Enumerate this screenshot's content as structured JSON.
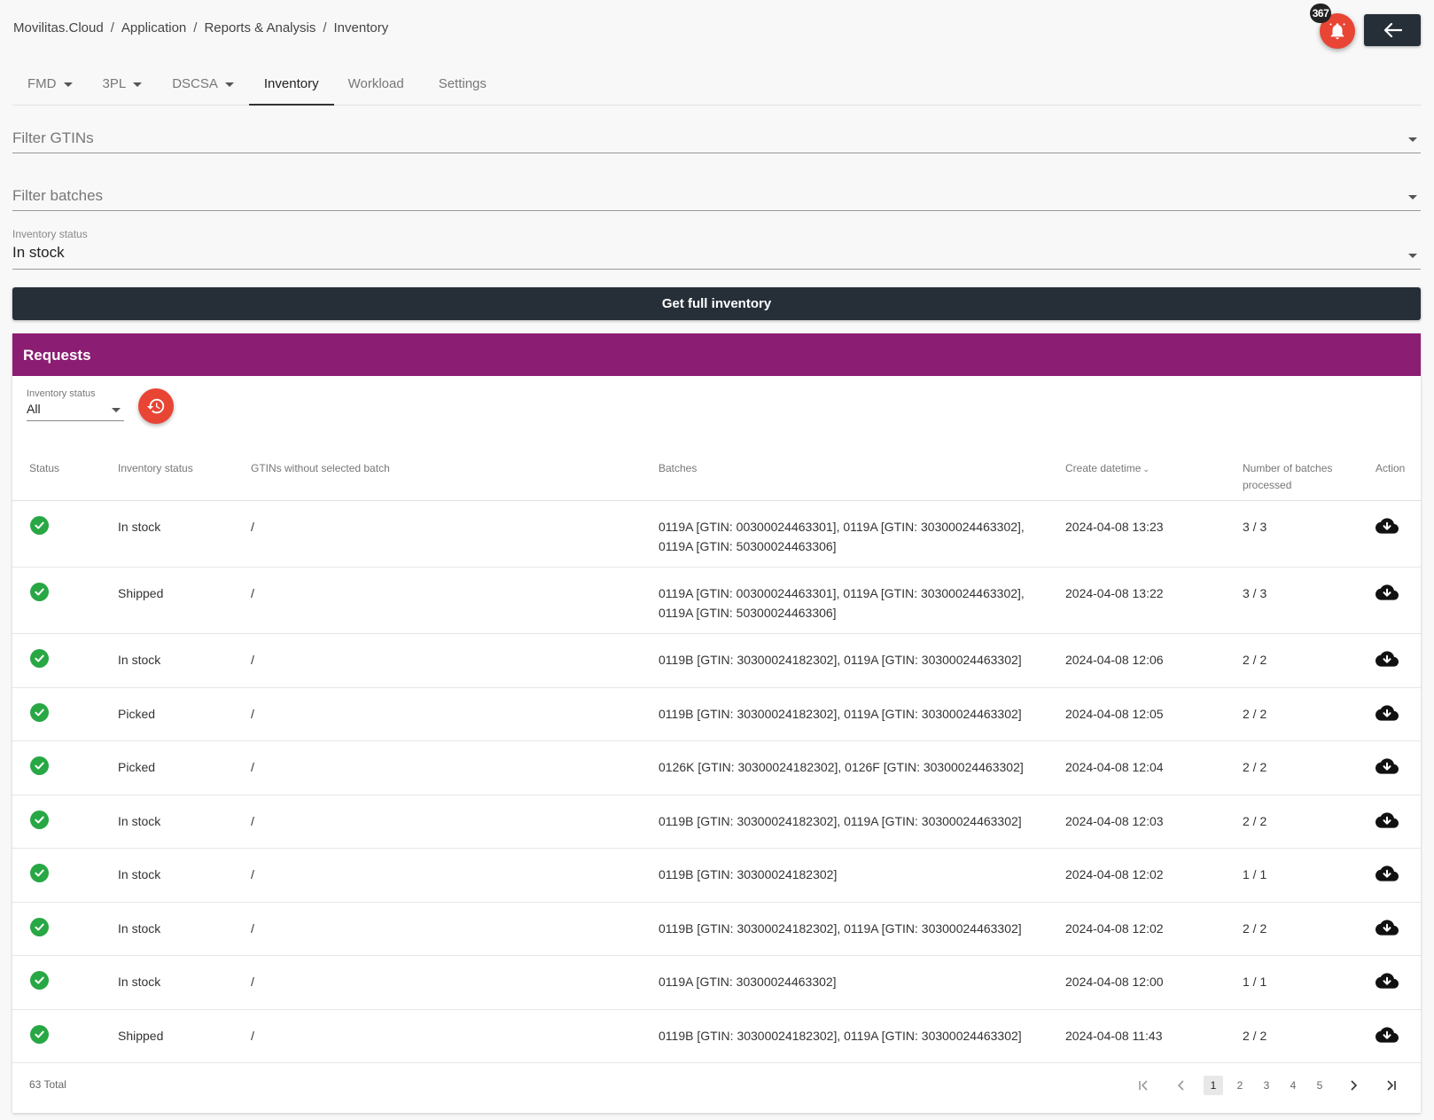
{
  "breadcrumb": [
    "Movilitas.Cloud",
    "Application",
    "Reports & Analysis",
    "Inventory"
  ],
  "notifications": {
    "count": "367",
    "icon": "bell-icon"
  },
  "back_icon": "arrow-left-icon",
  "tabs": [
    {
      "label": "FMD",
      "dropdown": true
    },
    {
      "label": "3PL",
      "dropdown": true
    },
    {
      "label": "DSCSA",
      "dropdown": true
    },
    {
      "label": "Inventory",
      "dropdown": false,
      "active": true
    },
    {
      "label": "Workload",
      "dropdown": false
    },
    {
      "label": "Settings",
      "dropdown": false
    }
  ],
  "filters": {
    "gtins_placeholder": "Filter GTINs",
    "batches_placeholder": "Filter batches",
    "inventory_status_label": "Inventory status",
    "inventory_status_value": "In stock"
  },
  "get_full_inventory_label": "Get full inventory",
  "requests": {
    "title": "Requests",
    "header_color": "#8b1d72",
    "filter_label": "Inventory status",
    "filter_value": "All",
    "history_icon": "history-icon",
    "columns": {
      "status": "Status",
      "inventory_status": "Inventory status",
      "gtins_without_batch": "GTINs without selected batch",
      "batches": "Batches",
      "create_datetime": "Create datetime",
      "batches_processed": "Number of batches processed",
      "action": "Action"
    },
    "rows": [
      {
        "inventory_status": "In stock",
        "gtins": "/",
        "batches": "0119A [GTIN: 00300024463301], 0119A [GTIN: 30300024463302], 0119A [GTIN: 50300024463306]",
        "datetime": "2024-04-08 13:23",
        "processed": "3 / 3"
      },
      {
        "inventory_status": "Shipped",
        "gtins": "/",
        "batches": "0119A [GTIN: 00300024463301], 0119A [GTIN: 30300024463302], 0119A [GTIN: 50300024463306]",
        "datetime": "2024-04-08 13:22",
        "processed": "3 / 3"
      },
      {
        "inventory_status": "In stock",
        "gtins": "/",
        "batches": "0119B [GTIN: 30300024182302], 0119A [GTIN: 30300024463302]",
        "datetime": "2024-04-08 12:06",
        "processed": "2 / 2"
      },
      {
        "inventory_status": "Picked",
        "gtins": "/",
        "batches": "0119B [GTIN: 30300024182302], 0119A [GTIN: 30300024463302]",
        "datetime": "2024-04-08 12:05",
        "processed": "2 / 2"
      },
      {
        "inventory_status": "Picked",
        "gtins": "/",
        "batches": "0126K [GTIN: 30300024182302], 0126F [GTIN: 30300024463302]",
        "datetime": "2024-04-08 12:04",
        "processed": "2 / 2"
      },
      {
        "inventory_status": "In stock",
        "gtins": "/",
        "batches": "0119B [GTIN: 30300024182302], 0119A [GTIN: 30300024463302]",
        "datetime": "2024-04-08 12:03",
        "processed": "2 / 2"
      },
      {
        "inventory_status": "In stock",
        "gtins": "/",
        "batches": "0119B [GTIN: 30300024182302]",
        "datetime": "2024-04-08 12:02",
        "processed": "1 / 1"
      },
      {
        "inventory_status": "In stock",
        "gtins": "/",
        "batches": "0119B [GTIN: 30300024182302], 0119A [GTIN: 30300024463302]",
        "datetime": "2024-04-08 12:02",
        "processed": "2 / 2"
      },
      {
        "inventory_status": "In stock",
        "gtins": "/",
        "batches": "0119A [GTIN: 30300024463302]",
        "datetime": "2024-04-08 12:00",
        "processed": "1 / 1"
      },
      {
        "inventory_status": "Shipped",
        "gtins": "/",
        "batches": "0119B [GTIN: 30300024182302], 0119A [GTIN: 30300024463302]",
        "datetime": "2024-04-08 11:43",
        "processed": "2 / 2"
      }
    ],
    "total_label": "63 Total",
    "pages": [
      "1",
      "2",
      "3",
      "4",
      "5"
    ],
    "current_page": "1"
  }
}
